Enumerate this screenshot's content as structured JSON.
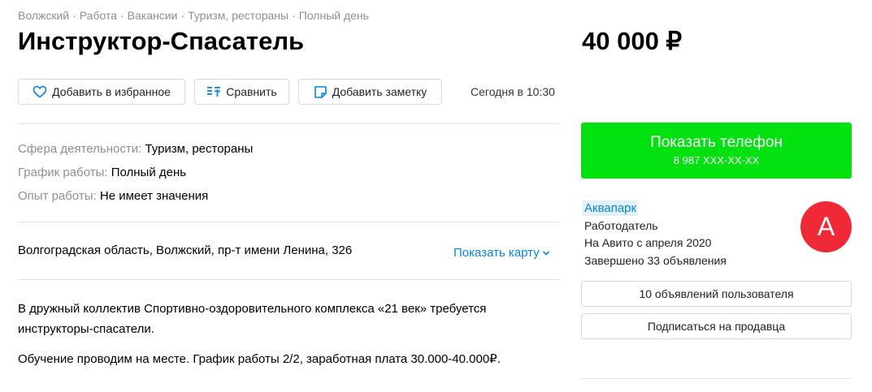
{
  "breadcrumbs": [
    "Волжский",
    "Работа",
    "Вакансии",
    "Туризм, рестораны",
    "Полный день"
  ],
  "breadcrumb_separator": "·",
  "title": "Инструктор-Спасатель",
  "price": "40 000 ₽",
  "actions": {
    "favorite_label": "Добавить в избранное",
    "compare_label": "Сравнить",
    "note_label": "Добавить заметку"
  },
  "date": "Сегодня в 10:30",
  "params": [
    {
      "label": "Сфера деятельности:",
      "value": "Туризм, рестораны"
    },
    {
      "label": "График работы:",
      "value": "Полный день"
    },
    {
      "label": "Опыт работы:",
      "value": "Не имеет значения"
    }
  ],
  "address": "Волгоградская область, Волжский, пр-т имени Ленина, 326",
  "show_map_label": "Показать карту",
  "description": [
    "В дружный коллектив Спортивно-оздоровительного комплекса «21 век» требуется инструкторы-спасатели.",
    "Обучение проводим на месте. График работы 2/2, заработная плата 30.000-40.000₽."
  ],
  "phone": {
    "label": "Показать телефон",
    "masked_number": "8 987 XXX-XX-XX"
  },
  "seller": {
    "name": "Аквапарк",
    "type": "Работодатель",
    "since": "На Авито с апреля 2020",
    "completed": "Завершено 33 объявления",
    "avatar_letter": "А"
  },
  "seller_actions": {
    "listings_label": "10 объявлений пользователя",
    "subscribe_label": "Подписаться на продавца"
  },
  "colors": {
    "accent_green": "#04e110",
    "link_blue": "#0a85d9",
    "avatar_red": "#ef2a36"
  },
  "icons": {
    "favorite": "heart-icon",
    "compare": "compare-icon",
    "note": "note-icon",
    "map": "chevron-down-icon"
  }
}
